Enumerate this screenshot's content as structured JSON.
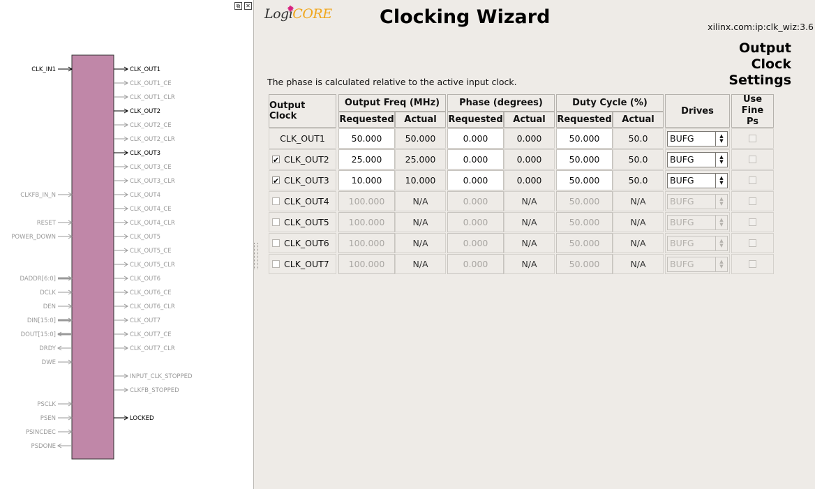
{
  "ip_core": {
    "logo_prefix": "Logi",
    "logo_core": "CORE",
    "title": "Clocking Wizard",
    "vlnv": "xilinx.com:ip:clk_wiz:3.6",
    "section_title": [
      "Output",
      "Clock",
      "Settings"
    ],
    "description": "The phase is calculated relative to the active input clock."
  },
  "colors": {
    "block_fill": "#c087a8",
    "active_port": "#000000",
    "inactive_port": "#999999",
    "pane_bg": "#eeebe7"
  },
  "symbol": {
    "left_ports": [
      {
        "name": "CLK_IN1",
        "active": true,
        "bus": false,
        "dir": "in"
      },
      {
        "name": "CLKFB_IN_N",
        "active": false,
        "bus": false,
        "dir": "in"
      },
      {
        "name": "RESET",
        "active": false,
        "bus": false,
        "dir": "in"
      },
      {
        "name": "POWER_DOWN",
        "active": false,
        "bus": false,
        "dir": "in"
      },
      {
        "name": "DADDR[6:0]",
        "active": false,
        "bus": true,
        "dir": "in"
      },
      {
        "name": "DCLK",
        "active": false,
        "bus": false,
        "dir": "in"
      },
      {
        "name": "DEN",
        "active": false,
        "bus": false,
        "dir": "in"
      },
      {
        "name": "DIN[15:0]",
        "active": false,
        "bus": true,
        "dir": "in"
      },
      {
        "name": "DOUT[15:0]",
        "active": false,
        "bus": true,
        "dir": "out"
      },
      {
        "name": "DRDY",
        "active": false,
        "bus": false,
        "dir": "out"
      },
      {
        "name": "DWE",
        "active": false,
        "bus": false,
        "dir": "in"
      },
      {
        "name": "PSCLK",
        "active": false,
        "bus": false,
        "dir": "in"
      },
      {
        "name": "PSEN",
        "active": false,
        "bus": false,
        "dir": "in"
      },
      {
        "name": "PSINCDEC",
        "active": false,
        "bus": false,
        "dir": "in"
      },
      {
        "name": "PSDONE",
        "active": false,
        "bus": false,
        "dir": "out"
      }
    ],
    "right_ports": [
      {
        "name": "CLK_OUT1",
        "active": true
      },
      {
        "name": "CLK_OUT1_CE",
        "active": false
      },
      {
        "name": "CLK_OUT1_CLR",
        "active": false
      },
      {
        "name": "CLK_OUT2",
        "active": true
      },
      {
        "name": "CLK_OUT2_CE",
        "active": false
      },
      {
        "name": "CLK_OUT2_CLR",
        "active": false
      },
      {
        "name": "CLK_OUT3",
        "active": true
      },
      {
        "name": "CLK_OUT3_CE",
        "active": false
      },
      {
        "name": "CLK_OUT3_CLR",
        "active": false
      },
      {
        "name": "CLK_OUT4",
        "active": false
      },
      {
        "name": "CLK_OUT4_CE",
        "active": false
      },
      {
        "name": "CLK_OUT4_CLR",
        "active": false
      },
      {
        "name": "CLK_OUT5",
        "active": false
      },
      {
        "name": "CLK_OUT5_CE",
        "active": false
      },
      {
        "name": "CLK_OUT5_CLR",
        "active": false
      },
      {
        "name": "CLK_OUT6",
        "active": false
      },
      {
        "name": "CLK_OUT6_CE",
        "active": false
      },
      {
        "name": "CLK_OUT6_CLR",
        "active": false
      },
      {
        "name": "CLK_OUT7",
        "active": false
      },
      {
        "name": "CLK_OUT7_CE",
        "active": false
      },
      {
        "name": "CLK_OUT7_CLR",
        "active": false
      },
      {
        "name": "INPUT_CLK_STOPPED",
        "active": false
      },
      {
        "name": "CLKFB_STOPPED",
        "active": false
      },
      {
        "name": "LOCKED",
        "active": true
      }
    ]
  },
  "table": {
    "headers": {
      "output_clock": "Output Clock",
      "output_freq": "Output Freq (MHz)",
      "phase": "Phase (degrees)",
      "duty": "Duty Cycle (%)",
      "drives": "Drives",
      "use_fine_ps": "Use Fine Ps",
      "requested": "Requested",
      "actual": "Actual"
    },
    "rows": [
      {
        "name": "CLK_OUT1",
        "has_checkbox": false,
        "checked": true,
        "enabled": true,
        "freq_req": "50.000",
        "freq_act": "50.000",
        "phase_req": "0.000",
        "phase_act": "0.000",
        "duty_req": "50.000",
        "duty_act": "50.0",
        "drives": "BUFG"
      },
      {
        "name": "CLK_OUT2",
        "has_checkbox": true,
        "checked": true,
        "enabled": true,
        "freq_req": "25.000",
        "freq_act": "25.000",
        "phase_req": "0.000",
        "phase_act": "0.000",
        "duty_req": "50.000",
        "duty_act": "50.0",
        "drives": "BUFG"
      },
      {
        "name": "CLK_OUT3",
        "has_checkbox": true,
        "checked": true,
        "enabled": true,
        "freq_req": "10.000",
        "freq_act": "10.000",
        "phase_req": "0.000",
        "phase_act": "0.000",
        "duty_req": "50.000",
        "duty_act": "50.0",
        "drives": "BUFG"
      },
      {
        "name": "CLK_OUT4",
        "has_checkbox": true,
        "checked": false,
        "enabled": false,
        "freq_req": "100.000",
        "freq_act": "N/A",
        "phase_req": "0.000",
        "phase_act": "N/A",
        "duty_req": "50.000",
        "duty_act": "N/A",
        "drives": "BUFG"
      },
      {
        "name": "CLK_OUT5",
        "has_checkbox": true,
        "checked": false,
        "enabled": false,
        "freq_req": "100.000",
        "freq_act": "N/A",
        "phase_req": "0.000",
        "phase_act": "N/A",
        "duty_req": "50.000",
        "duty_act": "N/A",
        "drives": "BUFG"
      },
      {
        "name": "CLK_OUT6",
        "has_checkbox": true,
        "checked": false,
        "enabled": false,
        "freq_req": "100.000",
        "freq_act": "N/A",
        "phase_req": "0.000",
        "phase_act": "N/A",
        "duty_req": "50.000",
        "duty_act": "N/A",
        "drives": "BUFG"
      },
      {
        "name": "CLK_OUT7",
        "has_checkbox": true,
        "checked": false,
        "enabled": false,
        "freq_req": "100.000",
        "freq_act": "N/A",
        "phase_req": "0.000",
        "phase_act": "N/A",
        "duty_req": "50.000",
        "duty_act": "N/A",
        "drives": "BUFG"
      }
    ]
  }
}
